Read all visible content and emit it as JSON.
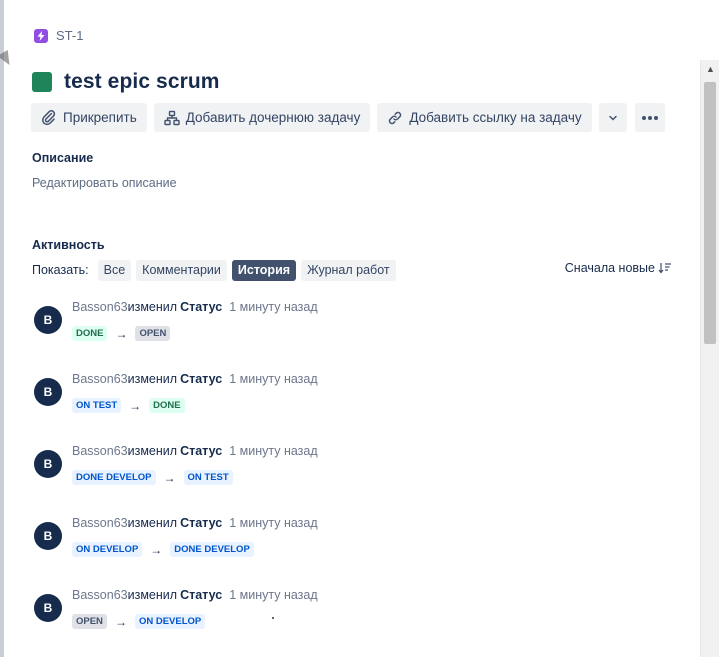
{
  "breadcrumb": {
    "issue_key": "ST-1",
    "icon": "lightning-icon"
  },
  "issue": {
    "title": "test epic scrum",
    "color": "#1f845a"
  },
  "toolbar": {
    "attach_label": "Прикрепить",
    "add_child_label": "Добавить дочернюю задачу",
    "add_link_label": "Добавить ссылку на задачу"
  },
  "description": {
    "heading": "Описание",
    "placeholder": "Редактировать описание"
  },
  "activity": {
    "heading": "Активность",
    "show_label": "Показать:",
    "filters": [
      "Все",
      "Комментарии",
      "История",
      "Журнал работ"
    ],
    "active_filter": "История",
    "sort_label": "Сначала новые"
  },
  "history": [
    {
      "avatar": "B",
      "author": "Basson63",
      "verb": "изменил",
      "field": "Статус",
      "time": "1 минуту назад",
      "from": "DONE",
      "from_color": "green",
      "to": "OPEN",
      "to_color": "gray"
    },
    {
      "avatar": "B",
      "author": "Basson63",
      "verb": "изменил",
      "field": "Статус",
      "time": "1 минуту назад",
      "from": "ON TEST",
      "from_color": "blue",
      "to": "DONE",
      "to_color": "green"
    },
    {
      "avatar": "B",
      "author": "Basson63",
      "verb": "изменил",
      "field": "Статус",
      "time": "1 минуту назад",
      "from": "DONE DEVELOP",
      "from_color": "blue",
      "to": "ON TEST",
      "to_color": "blue"
    },
    {
      "avatar": "B",
      "author": "Basson63",
      "verb": "изменил",
      "field": "Статус",
      "time": "1 минуту назад",
      "from": "ON DEVELOP",
      "from_color": "blue",
      "to": "DONE DEVELOP",
      "to_color": "blue"
    },
    {
      "avatar": "B",
      "author": "Basson63",
      "verb": "изменил",
      "field": "Статус",
      "time": "1 минуту назад",
      "from": "OPEN",
      "from_color": "gray",
      "to": "ON DEVELOP",
      "to_color": "blue"
    }
  ],
  "arrow_glyph": "→"
}
